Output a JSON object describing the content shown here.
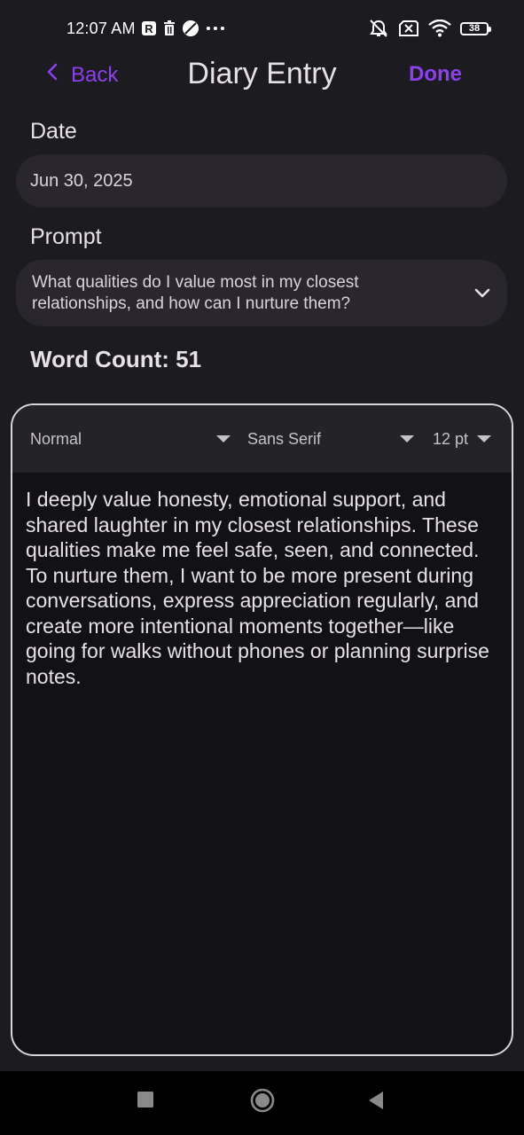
{
  "status_bar": {
    "time": "12:07 AM",
    "battery_level": "38",
    "icons": [
      "r-badge-icon",
      "trash-icon",
      "no-entry-icon",
      "more-dots-icon",
      "silent-icon",
      "no-sim-icon",
      "wifi-icon",
      "battery-icon"
    ]
  },
  "header": {
    "back_label": "Back",
    "title": "Diary Entry",
    "done_label": "Done",
    "accent_color": "#8e3ff0"
  },
  "date": {
    "label": "Date",
    "value": "Jun 30, 2025"
  },
  "prompt": {
    "label": "Prompt",
    "value": "What qualities do I value most in my closest relationships, and how can I nurture them?"
  },
  "word_count": {
    "label": "Word Count: 51"
  },
  "editor": {
    "toolbar": {
      "style": "Normal",
      "font": "Sans Serif",
      "size": "12 pt"
    },
    "content": "I deeply value honesty, emotional support, and shared laughter in my closest relationships. These qualities make me feel safe, seen, and connected. To nurture them, I want to be more present during conversations, express appreciation regularly, and create more intentional moments together—like going for walks without phones or planning surprise notes."
  },
  "nav_bar": {
    "icons": [
      "recents-square-icon",
      "home-circle-icon",
      "back-triangle-icon"
    ]
  }
}
